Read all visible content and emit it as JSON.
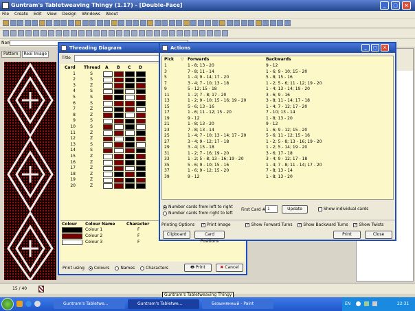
{
  "app": {
    "title": "Guntram's Tabletweaving Thingy (1.17) - [Double-Face]"
  },
  "menu": [
    "File",
    "Create",
    "Edit",
    "View",
    "Design",
    "Windows",
    "About"
  ],
  "namebar": {
    "label": "Name"
  },
  "left_tabs": [
    "Pattern",
    "Real Image"
  ],
  "status": {
    "position": "15 / 40"
  },
  "threading": {
    "title": "Threading Diagram",
    "title_label": "Title",
    "headers": [
      "Card",
      "Thread",
      "A",
      "B",
      "C",
      "D"
    ],
    "rows": [
      {
        "card": "1",
        "thread": "S",
        "holes": [
          "w",
          "r",
          "k",
          "k"
        ]
      },
      {
        "card": "2",
        "thread": "S",
        "holes": [
          "w",
          "r",
          "k",
          "k"
        ]
      },
      {
        "card": "3",
        "thread": "Z",
        "holes": [
          "w",
          "r",
          "k",
          "r"
        ]
      },
      {
        "card": "4",
        "thread": "S",
        "holes": [
          "w",
          "k",
          "w",
          "k"
        ]
      },
      {
        "card": "5",
        "thread": "S",
        "holes": [
          "r",
          "k",
          "w",
          "r"
        ]
      },
      {
        "card": "6",
        "thread": "S",
        "holes": [
          "w",
          "r",
          "r",
          "k"
        ]
      },
      {
        "card": "7",
        "thread": "Z",
        "holes": [
          "w",
          "k",
          "r",
          "w"
        ]
      },
      {
        "card": "8",
        "thread": "Z",
        "holes": [
          "r",
          "k",
          "w",
          "r"
        ]
      },
      {
        "card": "9",
        "thread": "S",
        "holes": [
          "w",
          "r",
          "k",
          "r"
        ]
      },
      {
        "card": "10",
        "thread": "S",
        "holes": [
          "r",
          "w",
          "k",
          "w"
        ]
      },
      {
        "card": "11",
        "thread": "Z",
        "holes": [
          "w",
          "r",
          "w",
          "k"
        ]
      },
      {
        "card": "12",
        "thread": "Z",
        "holes": [
          "r",
          "w",
          "k",
          "r"
        ]
      },
      {
        "card": "13",
        "thread": "S",
        "holes": [
          "w",
          "r",
          "k",
          "w"
        ]
      },
      {
        "card": "14",
        "thread": "S",
        "holes": [
          "r",
          "w",
          "r",
          "k"
        ]
      },
      {
        "card": "15",
        "thread": "Z",
        "holes": [
          "w",
          "r",
          "k",
          "r"
        ]
      },
      {
        "card": "16",
        "thread": "Z",
        "holes": [
          "w",
          "r",
          "k",
          "k"
        ]
      },
      {
        "card": "17",
        "thread": "Z",
        "holes": [
          "w",
          "r",
          "w",
          "k"
        ]
      },
      {
        "card": "18",
        "thread": "Z",
        "holes": [
          "w",
          "k",
          "r",
          "k"
        ]
      },
      {
        "card": "19",
        "thread": "Z",
        "holes": [
          "w",
          "r",
          "k",
          "r"
        ]
      },
      {
        "card": "20",
        "thread": "Z",
        "holes": [
          "w",
          "r",
          "k",
          "k"
        ]
      }
    ],
    "colour_headers": [
      "Colour",
      "Colour Name",
      "Character"
    ],
    "colours": [
      {
        "name": "Colour 1",
        "char": "F",
        "hex": "#000000"
      },
      {
        "name": "Colour 2",
        "char": "F",
        "hex": "#7a0000"
      },
      {
        "name": "Colour 3",
        "char": "F",
        "hex": "#ffffff"
      }
    ],
    "print_using": "Print using",
    "print_options": [
      "Colours",
      "Names",
      "Characters"
    ],
    "print_button": "Print",
    "cancel_button": "Cancel"
  },
  "actions": {
    "title": "Actions",
    "headers": [
      "Pick",
      "Forwards",
      "Backwards"
    ],
    "rows": [
      {
        "pick": "1",
        "fwd": "1 - 8; 13 - 20",
        "bwd": "9 - 12"
      },
      {
        "pick": "3",
        "fwd": "7 - 8; 11 - 14",
        "bwd": "1 - 6; 9 - 10; 15 - 20"
      },
      {
        "pick": "5",
        "fwd": "1 - 4; 9 - 14; 17 - 20",
        "bwd": "5 - 8; 15 - 16"
      },
      {
        "pick": "7",
        "fwd": "3 - 4; 7 - 10; 13 - 18",
        "bwd": "1 - 2; 5 - 6; 11 - 12; 19 - 20"
      },
      {
        "pick": "9",
        "fwd": "5 - 12; 15 - 18",
        "bwd": "1 - 4; 13 - 14; 19 - 20"
      },
      {
        "pick": "11",
        "fwd": "1 - 2; 7 - 8; 17 - 20",
        "bwd": "3 - 6; 9 - 16"
      },
      {
        "pick": "13",
        "fwd": "1 - 2; 9 - 10; 15 - 16; 19 - 20",
        "bwd": "3 - 8; 11 - 14; 17 - 18"
      },
      {
        "pick": "15",
        "fwd": "5 - 6; 13 - 16",
        "bwd": "1 - 4; 7 - 12; 17 - 20"
      },
      {
        "pick": "17",
        "fwd": "1 - 6; 11 - 12; 15 - 20",
        "bwd": "7 - 10; 13 - 14"
      },
      {
        "pick": "19",
        "fwd": "9 - 12",
        "bwd": "1 - 8; 13 - 20"
      },
      {
        "pick": "21",
        "fwd": "1 - 8; 13 - 20",
        "bwd": "9 - 12"
      },
      {
        "pick": "23",
        "fwd": "7 - 8; 13 - 14",
        "bwd": "1 - 6; 9 - 12; 15 - 20"
      },
      {
        "pick": "25",
        "fwd": "1 - 4; 7 - 10; 13 - 14; 17 - 20",
        "bwd": "5 - 6; 11 - 12; 15 - 16"
      },
      {
        "pick": "27",
        "fwd": "3 - 4; 9 - 12; 17 - 18",
        "bwd": "1 - 2; 5 - 8; 13 - 16; 19 - 20"
      },
      {
        "pick": "29",
        "fwd": "3 - 4; 15 - 18",
        "bwd": "1 - 2; 5 - 14; 19 - 20"
      },
      {
        "pick": "31",
        "fwd": "1 - 2; 7 - 16; 19 - 20",
        "bwd": "3 - 6; 17 - 18"
      },
      {
        "pick": "33",
        "fwd": "1 - 2; 5 - 8; 13 - 16; 19 - 20",
        "bwd": "3 - 4; 9 - 12; 17 - 18"
      },
      {
        "pick": "35",
        "fwd": "5 - 6; 9 - 10; 15 - 16",
        "bwd": "1 - 4; 7 - 8; 11 - 14; 17 - 20"
      },
      {
        "pick": "37",
        "fwd": "1 - 6; 9 - 12; 15 - 20",
        "bwd": "7 - 8; 13 - 14"
      },
      {
        "pick": "39",
        "fwd": "9 - 12",
        "bwd": "1 - 8; 13 - 20"
      }
    ],
    "num_left_right": "Number cards from left to right",
    "num_right_left": "Number cards from right to left",
    "first_card_label": "First Card #",
    "first_card_value": "1",
    "update_button": "Update",
    "show_individual": "Show individual cards",
    "printing_options": "Printing Options",
    "print_image": "Print Image",
    "show_forward": "Show Forward Turns",
    "show_backward": "Show Backward Turns",
    "show_twists": "Show Twists",
    "clipboard_button": "Clipboard",
    "card_positions_button": "Card Positions",
    "print_button": "Print",
    "close_button": "Close"
  },
  "tooltip": "Guntram's Tabletweaving Thingy",
  "taskbar": {
    "items": [
      "Guntram's Tabletwe...",
      "Guntram's Tabletwe...",
      "Безымянный - Paint"
    ],
    "lang": "EN",
    "clock": "22:31"
  }
}
